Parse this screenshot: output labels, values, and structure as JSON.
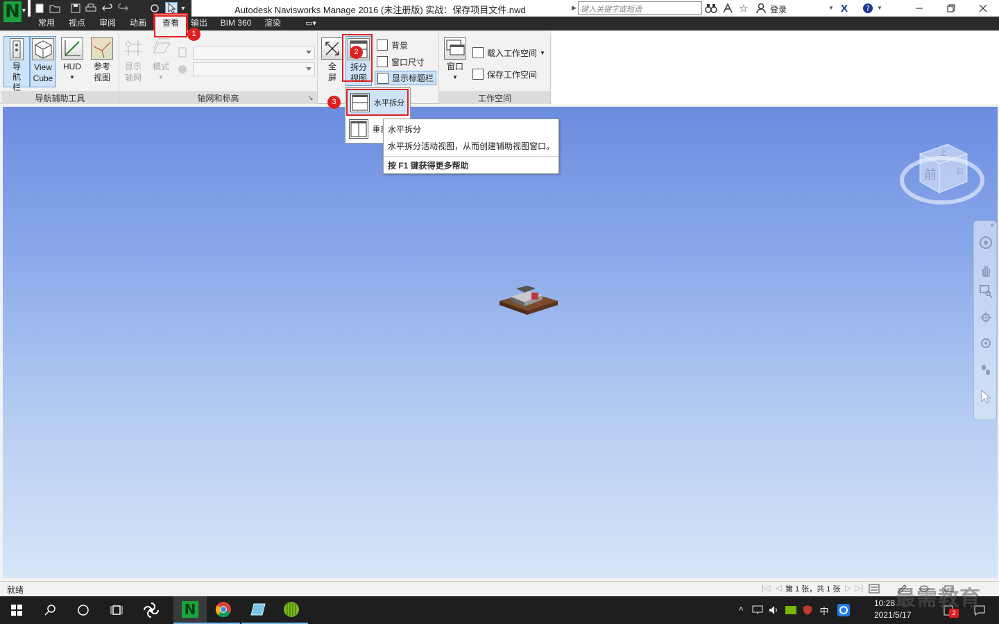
{
  "window": {
    "title": "Autodesk Navisworks Manage 2016 (未注册版)     实战：保存项目文件.nwd",
    "search_placeholder": "键入关键字或短语",
    "login": "登录"
  },
  "tabs": [
    "常用",
    "视点",
    "审阅",
    "动画",
    "查看",
    "输出",
    "BIM 360",
    "渲染"
  ],
  "active_tab": "查看",
  "ribbon": {
    "nav_aids": {
      "buttons": [
        {
          "label": "导航栏",
          "label2": ""
        },
        {
          "label": "View",
          "label2": "Cube"
        },
        {
          "label": "HUD",
          "label2": ""
        },
        {
          "label": "参考",
          "label2": "视图"
        }
      ],
      "title": "导航辅助工具"
    },
    "grid_levels": {
      "buttons": [
        {
          "label": "显示",
          "label2": "轴网"
        },
        {
          "label": "模式",
          "label2": ""
        }
      ],
      "title": "轴网和标高"
    },
    "scene_view": {
      "fullscreen": {
        "label": "全",
        "label2": "屏"
      },
      "split": {
        "label": "拆分",
        "label2": "视图"
      },
      "small": [
        "背景",
        "窗口尺寸",
        "显示标题栏"
      ]
    },
    "workspace": {
      "window": "窗口",
      "load": "载入工作空间",
      "save": "保存工作空间",
      "title": "工作空间"
    }
  },
  "split_menu": {
    "horizontal": "水平拆分",
    "vertical": "垂直"
  },
  "tooltip": {
    "title": "水平拆分",
    "desc": "水平拆分活动视图，从而创建辅助视图窗口。",
    "help": "按 F1 键获得更多帮助"
  },
  "badges": [
    "1",
    "2",
    "3"
  ],
  "viewcube": {
    "face": "前",
    "top": "上",
    "right": "右"
  },
  "status": {
    "text": "就绪",
    "page": "第 1 张，共 1 张"
  },
  "taskbar": {
    "time": "10:28",
    "date": "2021/5/17",
    "ime": "中",
    "notifications": "2",
    "watermark": "最需教育"
  },
  "colors": {
    "accent_red": "#e02020",
    "ribbon_dark": "#2b2b2b",
    "viewport_top": "#6b8ce0",
    "viewport_bottom": "#d6e6f8",
    "selected_blue": "#cde3f7"
  }
}
